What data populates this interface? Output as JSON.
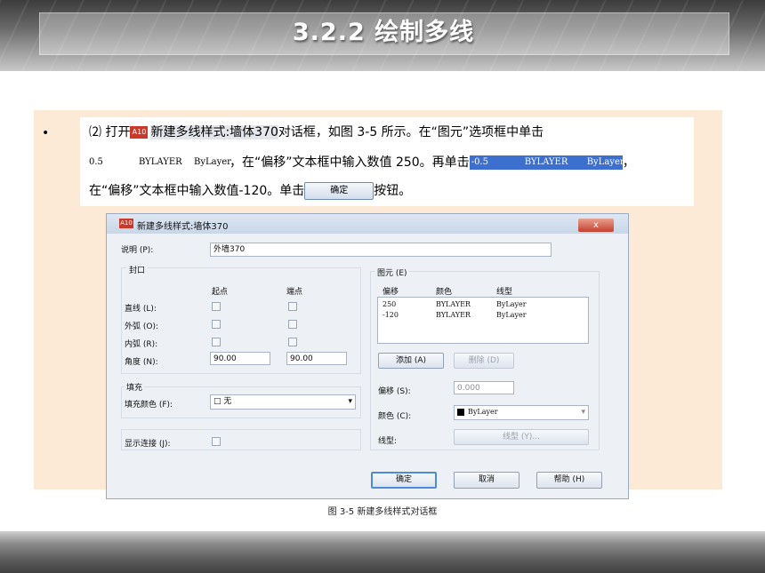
{
  "slide": {
    "title": "3.2.2  绘制多线",
    "bullet": "•",
    "caption": "图 3-5    新建多线样式对话框"
  },
  "instructions": {
    "line1_prefix": "⑵ 打开",
    "icon_label": "A10",
    "dialog_name": "新建多线样式:墙体370",
    "line1_suffix": "对话框，如图 3-5 所示。在“图元”选项框中单击",
    "row1_offset": "0.5",
    "row1_color": "BYLAYER",
    "row1_linetype": "ByLayer",
    "line2_mid": "，在“偏移”文本框中输入数值 250。再单击",
    "row2_offset": "-0.5",
    "row2_color": "BYLAYER",
    "row2_linetype": "ByLayer",
    "line2_end": "，",
    "line3_prefix": "在“偏移”文本框中输入数值-120。单击",
    "ok_label": "确定",
    "line3_suffix": "按钮。"
  },
  "dialog": {
    "title": "新建多线样式:墙体370",
    "icon_label": "A10",
    "close_label": "x",
    "description_label": "说明 (P):",
    "description_value": "外墙370",
    "caps": {
      "group_label": "封口",
      "start_header": "起点",
      "end_header": "端点",
      "rows": [
        {
          "label": "直线 (L):"
        },
        {
          "label": "外弧 (O):"
        },
        {
          "label": "内弧 (R):"
        }
      ],
      "angle_label": "角度 (N):",
      "angle_start": "90.00",
      "angle_end": "90.00"
    },
    "fill": {
      "group_label": "填充",
      "color_label": "填充颜色 (F):",
      "color_value": "□ 无",
      "dropdown_arrow": "▾"
    },
    "joints": {
      "label": "显示连接 (J):"
    },
    "elements": {
      "group_label": "图元 (E)",
      "columns": [
        "偏移",
        "颜色",
        "线型"
      ],
      "rows": [
        {
          "offset": "250",
          "color": "BYLAYER",
          "linetype": "ByLayer"
        },
        {
          "offset": "-120",
          "color": "BYLAYER",
          "linetype": "ByLayer"
        }
      ],
      "add_label": "添加 (A)",
      "delete_label": "删除 (D)",
      "offset_label": "偏移 (S):",
      "offset_value": "0.000",
      "color_label": "颜色 (C):",
      "color_value": "ByLayer",
      "color_swatch": "#000000",
      "linetype_label": "线型:",
      "linetype_button": "线型 (Y)..."
    },
    "buttons": {
      "ok": "确定",
      "cancel": "取消",
      "help": "帮助 (H)"
    }
  }
}
